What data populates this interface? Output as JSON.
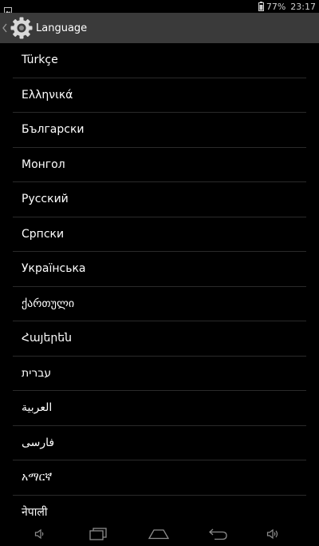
{
  "status_bar": {
    "battery_percent": "77%",
    "time": "23:17"
  },
  "action_bar": {
    "title": "Language"
  },
  "languages": [
    "Türkçe",
    "Ελληνικά",
    "Български",
    "Монгол",
    "Русский",
    "Српски",
    "Українська",
    "ქართული",
    "Հայերեն",
    "עברית",
    "العربية",
    "فارسی",
    "አማርኛ",
    "नेपाली"
  ],
  "icons": {
    "status_left": "image-notification-icon",
    "battery": "battery-icon",
    "up": "chevron-left-icon",
    "app": "settings-gear-icon",
    "nav": [
      "volume-down-icon",
      "recent-apps-icon",
      "home-icon",
      "back-icon",
      "volume-up-icon"
    ]
  },
  "colors": {
    "background": "#000000",
    "action_bar": "#3a3a3a",
    "divider": "#2a2a2a",
    "text": "#ffffff"
  }
}
